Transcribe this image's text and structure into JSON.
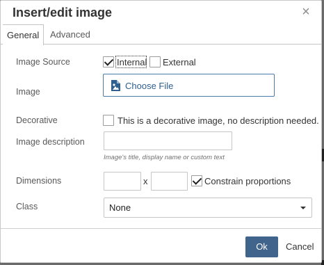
{
  "dialog": {
    "title": "Insert/edit image",
    "close_glyph": "×"
  },
  "tabs": [
    {
      "label": "General",
      "active": true
    },
    {
      "label": "Advanced",
      "active": false
    }
  ],
  "fields": {
    "image_source": {
      "label": "Image Source",
      "internal": {
        "label": "Internal",
        "checked": true
      },
      "external": {
        "label": "External",
        "checked": false
      }
    },
    "image": {
      "label": "Image",
      "button_label": "Choose File",
      "icon": "image-file-icon"
    },
    "decorative": {
      "label": "Decorative",
      "checkbox_label": "This is a decorative image, no description needed.",
      "checked": false
    },
    "description": {
      "label": "Image description",
      "value": "",
      "hint": "Image's title, display name or custom text"
    },
    "dimensions": {
      "label": "Dimensions",
      "width_value": "",
      "height_value": "",
      "separator": "x",
      "constrain_label": "Constrain proportions",
      "constrain_checked": true
    },
    "class": {
      "label": "Class",
      "selected": "None"
    }
  },
  "footer": {
    "ok_label": "Ok",
    "cancel_label": "Cancel"
  },
  "colors": {
    "accent": "#40648c",
    "link": "#2f5f8f",
    "backdrop": "#6f6f6f"
  }
}
